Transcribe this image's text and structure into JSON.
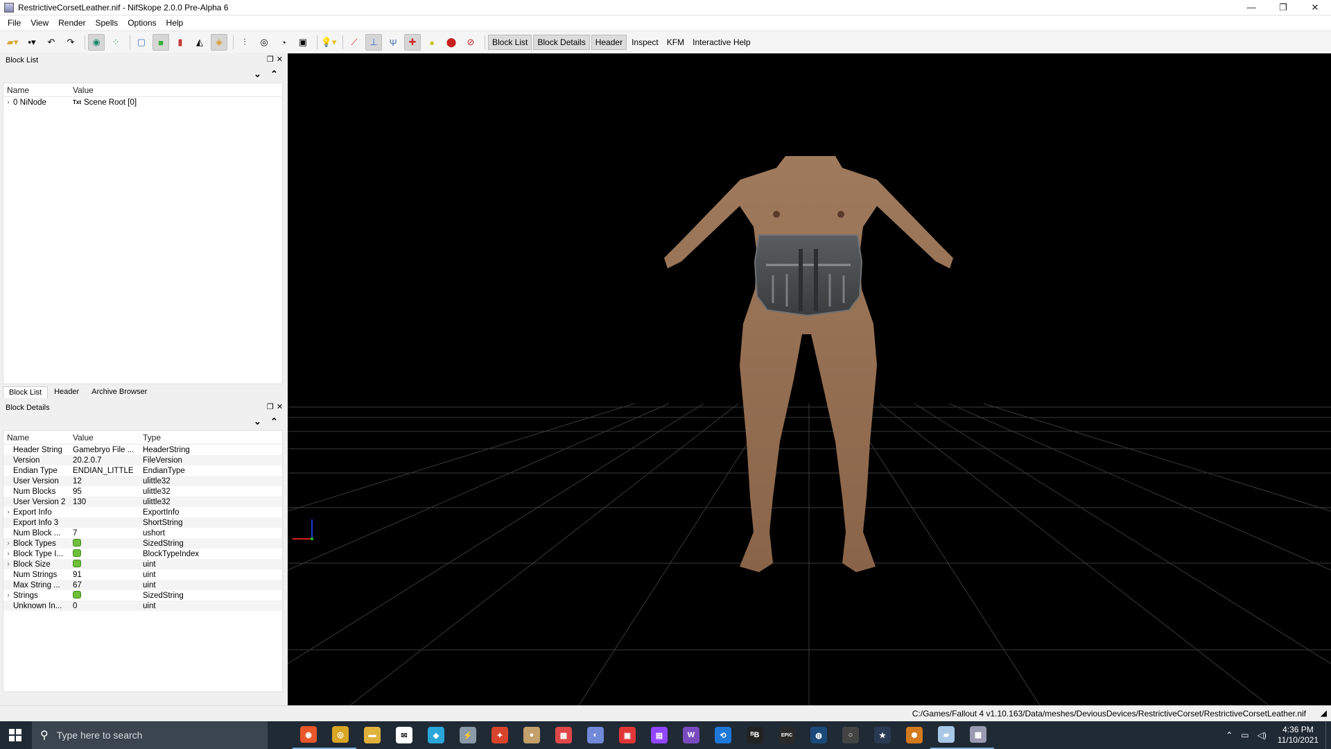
{
  "window": {
    "title": "RestrictiveCorsetLeather.nif - NifSkope 2.0.0 Pre-Alpha 6",
    "controls": [
      "—",
      "❐",
      "✕"
    ]
  },
  "menu": [
    "File",
    "View",
    "Render",
    "Spells",
    "Options",
    "Help"
  ],
  "toolbar": {
    "text_buttons": [
      {
        "label": "Block List",
        "active": true
      },
      {
        "label": "Block Details",
        "active": true
      },
      {
        "label": "Header",
        "active": true
      },
      {
        "label": "Inspect",
        "active": false
      },
      {
        "label": "KFM",
        "active": false
      },
      {
        "label": "Interactive Help",
        "active": false
      }
    ]
  },
  "block_list": {
    "title": "Block List",
    "columns": [
      "Name",
      "Value"
    ],
    "rows": [
      {
        "name": "0 NiNode",
        "badge": "Txt",
        "value": "Scene Root [0]"
      }
    ]
  },
  "tabs": [
    "Block List",
    "Header",
    "Archive Browser"
  ],
  "block_details": {
    "title": "Block Details",
    "columns": [
      "Name",
      "Value",
      "Type"
    ],
    "rows": [
      {
        "name": "Header String",
        "value": "Gamebryo File ...",
        "type": "HeaderString",
        "expand": false,
        "icon": false
      },
      {
        "name": "Version",
        "value": "20.2.0.7",
        "type": "FileVersion",
        "expand": false,
        "icon": false
      },
      {
        "name": "Endian Type",
        "value": "ENDIAN_LITTLE",
        "type": "EndianType",
        "expand": false,
        "icon": false
      },
      {
        "name": "User Version",
        "value": "12",
        "type": "ulittle32",
        "expand": false,
        "icon": false
      },
      {
        "name": "Num Blocks",
        "value": "95",
        "type": "ulittle32",
        "expand": false,
        "icon": false
      },
      {
        "name": "User Version 2",
        "value": "130",
        "type": "ulittle32",
        "expand": false,
        "icon": false
      },
      {
        "name": "Export Info",
        "value": "",
        "type": "ExportInfo",
        "expand": true,
        "icon": false
      },
      {
        "name": "Export Info 3",
        "value": "",
        "type": "ShortString",
        "expand": false,
        "icon": false
      },
      {
        "name": "Num Block ...",
        "value": "7",
        "type": "ushort",
        "expand": false,
        "icon": false
      },
      {
        "name": "Block Types",
        "value": "",
        "type": "SizedString",
        "expand": true,
        "icon": true
      },
      {
        "name": "Block Type I...",
        "value": "",
        "type": "BlockTypeIndex",
        "expand": true,
        "icon": true
      },
      {
        "name": "Block Size",
        "value": "",
        "type": "uint",
        "expand": true,
        "icon": true
      },
      {
        "name": "Num Strings",
        "value": "91",
        "type": "uint",
        "expand": false,
        "icon": false
      },
      {
        "name": "Max String ...",
        "value": "67",
        "type": "uint",
        "expand": false,
        "icon": false
      },
      {
        "name": "Strings",
        "value": "",
        "type": "SizedString",
        "expand": true,
        "icon": true
      },
      {
        "name": "Unknown In...",
        "value": "0",
        "type": "uint",
        "expand": false,
        "icon": false
      }
    ]
  },
  "status": {
    "path": "C:/Games/Fallout 4 v1.10.163/Data/meshes/DeviousDevices/RestrictiveCorset/RestrictiveCorsetLeather.nif"
  },
  "taskbar": {
    "search_placeholder": "Type here to search",
    "apps": [
      {
        "name": "firefox-icon",
        "color": "#e8562a",
        "glyph": "◉",
        "running": true
      },
      {
        "name": "chrome-icon",
        "color": "#d9a623",
        "glyph": "◎",
        "running": true
      },
      {
        "name": "file-explorer-icon",
        "color": "#e0b23c",
        "glyph": "▬",
        "running": false
      },
      {
        "name": "mail-icon",
        "color": "#ffffff",
        "glyph": "✉",
        "running": false
      },
      {
        "name": "box-app-icon",
        "color": "#2aa6d8",
        "glyph": "◆",
        "running": false
      },
      {
        "name": "tool-app-icon",
        "color": "#8a9aa8",
        "glyph": "⚡",
        "running": false
      },
      {
        "name": "fox-app-icon",
        "color": "#d8432c",
        "glyph": "✦",
        "running": false
      },
      {
        "name": "orb-app-icon",
        "color": "#c4a06a",
        "glyph": "●",
        "running": false
      },
      {
        "name": "calendar-app-icon",
        "color": "#e04848",
        "glyph": "▦",
        "running": false
      },
      {
        "name": "discord-icon",
        "color": "#7289da",
        "glyph": "◐",
        "running": false
      },
      {
        "name": "red-app-icon",
        "color": "#e03636",
        "glyph": "▣",
        "running": false
      },
      {
        "name": "twitch-icon",
        "color": "#9146ff",
        "glyph": "▤",
        "running": false
      },
      {
        "name": "w-app-icon",
        "color": "#7a4bc0",
        "glyph": "W",
        "running": false
      },
      {
        "name": "blue-app-icon",
        "color": "#1e78d8",
        "glyph": "⟲",
        "running": false
      },
      {
        "name": "b-app-icon",
        "color": "#222222",
        "glyph": "ᴮB",
        "running": false
      },
      {
        "name": "epic-games-icon",
        "color": "#2a2a2a",
        "glyph": "EPIC",
        "running": false
      },
      {
        "name": "steam-icon",
        "color": "#1b4a7a",
        "glyph": "◍",
        "running": false
      },
      {
        "name": "ring-app-icon",
        "color": "#444444",
        "glyph": "○",
        "running": false
      },
      {
        "name": "star-app-icon",
        "color": "#2a3a55",
        "glyph": "★",
        "running": false
      },
      {
        "name": "orange-app-icon",
        "color": "#d47a1e",
        "glyph": "✺",
        "running": false
      },
      {
        "name": "notepad-icon",
        "color": "#a8c8e8",
        "glyph": "▰",
        "running": true
      },
      {
        "name": "nifskope-icon",
        "color": "#9a9ab0",
        "glyph": "▩",
        "running": true
      }
    ],
    "time": "4:36 PM",
    "date": "11/10/2021"
  }
}
